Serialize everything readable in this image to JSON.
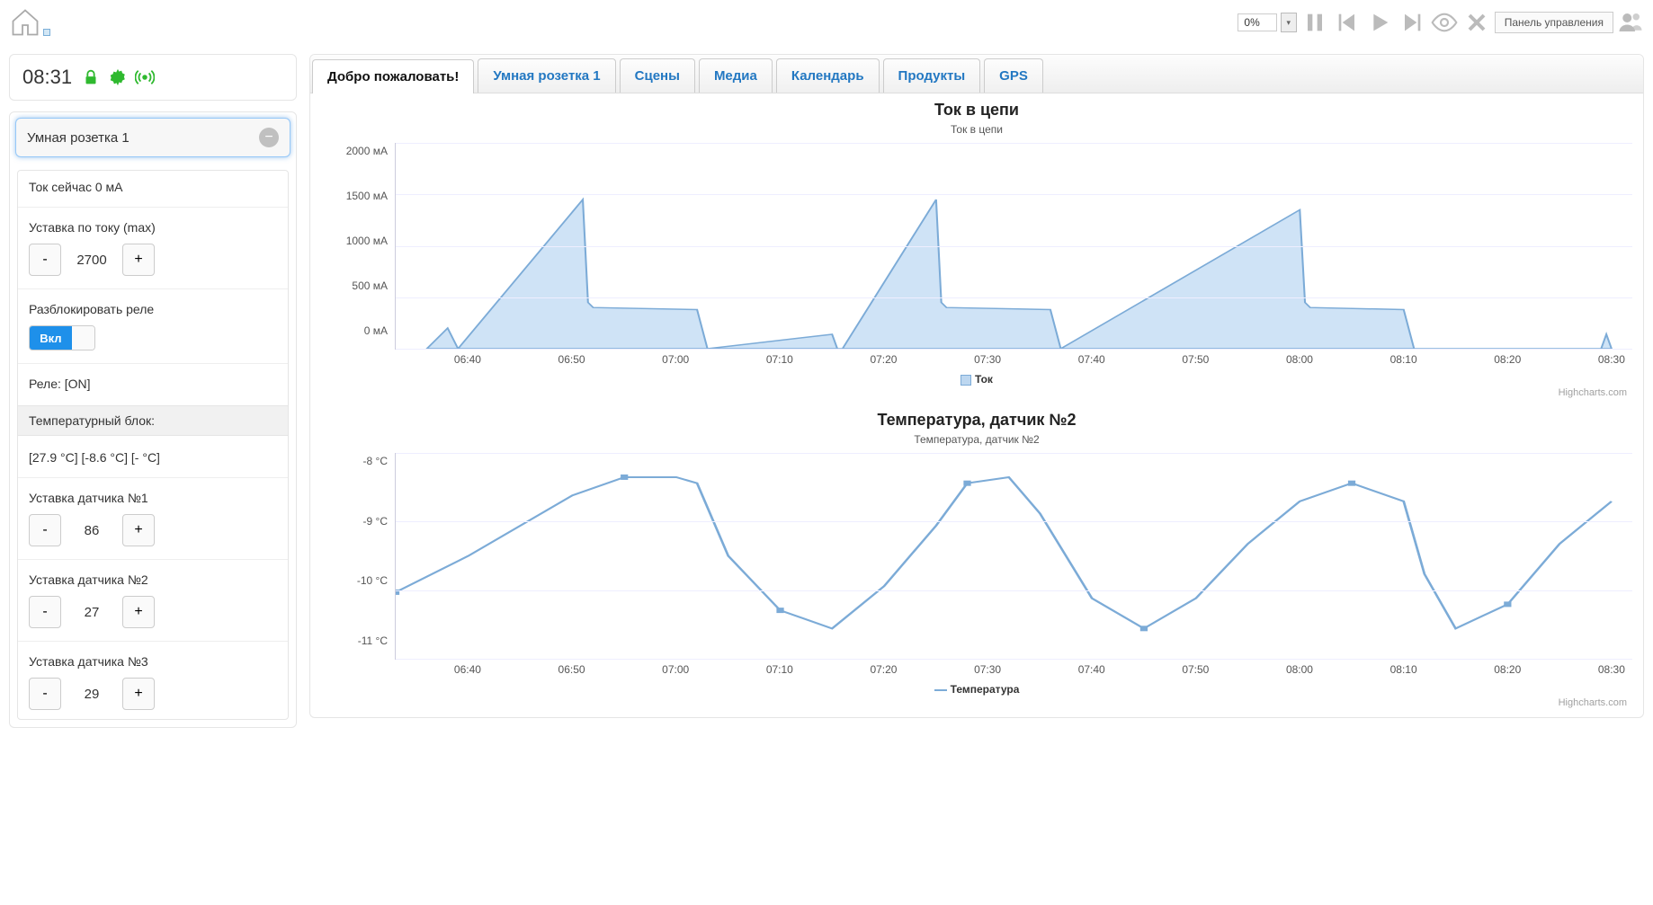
{
  "topbar": {
    "percent": "0%",
    "control_panel": "Панель управления"
  },
  "sidebar": {
    "clock": "08:31",
    "panel_title": "Умная розетка 1",
    "current_now": "Ток сейчас 0 мА",
    "setpoint_current": "Уставка по току (max)",
    "setpoint_current_value": "2700",
    "unlock_relay": "Разблокировать реле",
    "toggle_on": "Вкл",
    "relay_status": "Реле: [ON]",
    "temp_block": "Температурный блок:",
    "temp_readings": "[27.9 °C] [-8.6 °C] [- °C]",
    "sensor1_label": "Уставка датчика №1",
    "sensor1_value": "86",
    "sensor2_label": "Уставка датчика №2",
    "sensor2_value": "27",
    "sensor3_label": "Уставка датчика №3",
    "sensor3_value": "29"
  },
  "tabs": {
    "welcome": "Добро пожаловать!",
    "socket": "Умная розетка 1",
    "scenes": "Сцены",
    "media": "Медиа",
    "calendar": "Календарь",
    "products": "Продукты",
    "gps": "GPS"
  },
  "chart1": {
    "title": "Ток в цепи",
    "subtitle": "Ток в цепи",
    "legend": "Ток",
    "credit": "Highcharts.com"
  },
  "chart2": {
    "title": "Температура, датчик №2",
    "subtitle": "Температура, датчик №2",
    "legend": "Температура",
    "credit": "Highcharts.com"
  },
  "chart_data": [
    {
      "type": "area",
      "title": "Ток в цепи",
      "subtitle": "Ток в цепи",
      "xlabel": "",
      "ylabel": "",
      "x_ticks": [
        "06:40",
        "06:50",
        "07:00",
        "07:10",
        "07:20",
        "07:30",
        "07:40",
        "07:50",
        "08:00",
        "08:10",
        "08:20",
        "08:30"
      ],
      "y_ticks": [
        "0 мА",
        "500 мА",
        "1000 мА",
        "1500 мА",
        "2000 мА"
      ],
      "ylim": [
        0,
        2000
      ],
      "series": [
        {
          "name": "Ток",
          "x": [
            "06:36",
            "06:38",
            "06:39",
            "06:51",
            "06:51.5",
            "06:52",
            "07:02",
            "07:03",
            "07:15",
            "07:15.5",
            "07:16",
            "07:25",
            "07:25.5",
            "07:26",
            "07:36",
            "07:37",
            "08:00",
            "08:00.5",
            "08:01",
            "08:10",
            "08:11",
            "08:29",
            "08:29.5",
            "08:30"
          ],
          "y": [
            0,
            200,
            0,
            1450,
            450,
            400,
            380,
            0,
            140,
            0,
            0,
            1450,
            450,
            400,
            380,
            0,
            1350,
            450,
            400,
            380,
            0,
            0,
            140,
            0
          ]
        }
      ]
    },
    {
      "type": "line",
      "title": "Температура, датчик №2",
      "subtitle": "Температура, датчик №2",
      "xlabel": "",
      "ylabel": "",
      "x_ticks": [
        "06:40",
        "06:50",
        "07:00",
        "07:10",
        "07:20",
        "07:30",
        "07:40",
        "07:50",
        "08:00",
        "08:10",
        "08:20",
        "08:30"
      ],
      "y_ticks": [
        "-11 °C",
        "-10 °C",
        "-9 °C",
        "-8 °C"
      ],
      "ylim": [
        -11.2,
        -7.8
      ],
      "series": [
        {
          "name": "Температура",
          "x": [
            "06:33",
            "06:40",
            "06:45",
            "06:50",
            "06:55",
            "07:00",
            "07:02",
            "07:05",
            "07:10",
            "07:15",
            "07:20",
            "07:25",
            "07:28",
            "07:32",
            "07:35",
            "07:40",
            "07:45",
            "07:50",
            "07:55",
            "08:00",
            "08:05",
            "08:10",
            "08:12",
            "08:15",
            "08:20",
            "08:25",
            "08:30"
          ],
          "y": [
            -10.1,
            -9.5,
            -9.0,
            -8.5,
            -8.2,
            -8.2,
            -8.3,
            -9.5,
            -10.4,
            -10.7,
            -10.0,
            -9.0,
            -8.3,
            -8.2,
            -8.8,
            -10.2,
            -10.7,
            -10.2,
            -9.3,
            -8.6,
            -8.3,
            -8.6,
            -9.8,
            -10.7,
            -10.3,
            -9.3,
            -8.6
          ]
        }
      ]
    }
  ]
}
